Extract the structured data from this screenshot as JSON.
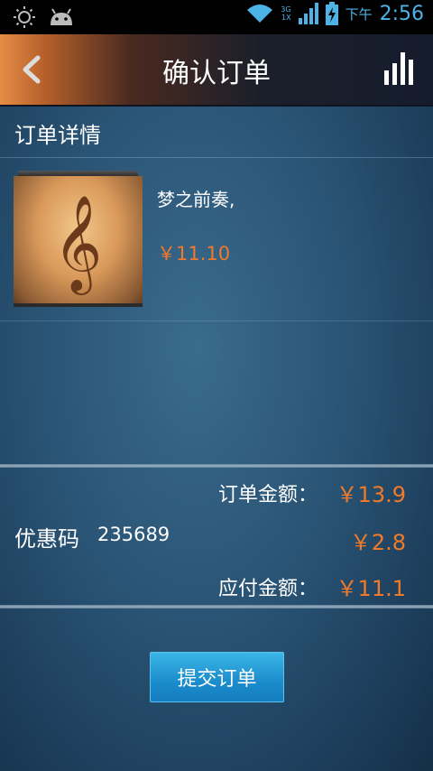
{
  "status_bar": {
    "ampm": "下午",
    "time": "2:56",
    "network": "3G",
    "network_sub": "1X"
  },
  "header": {
    "title": "确认订单"
  },
  "section": {
    "title": "订单详情"
  },
  "product": {
    "name": "梦之前奏,",
    "price": "￥11.10"
  },
  "summary": {
    "order_amount_label": "订单金额：",
    "order_amount_value": "￥13.9",
    "coupon_label": "优惠码",
    "coupon_code": "235689",
    "coupon_value": "￥2.8",
    "payable_label": "应付金额：",
    "payable_value": "￥11.1"
  },
  "actions": {
    "submit_label": "提交订单"
  },
  "colors": {
    "accent": "#f07a2a",
    "button": "#1b8ccc",
    "status_blue": "#4db3e6"
  }
}
